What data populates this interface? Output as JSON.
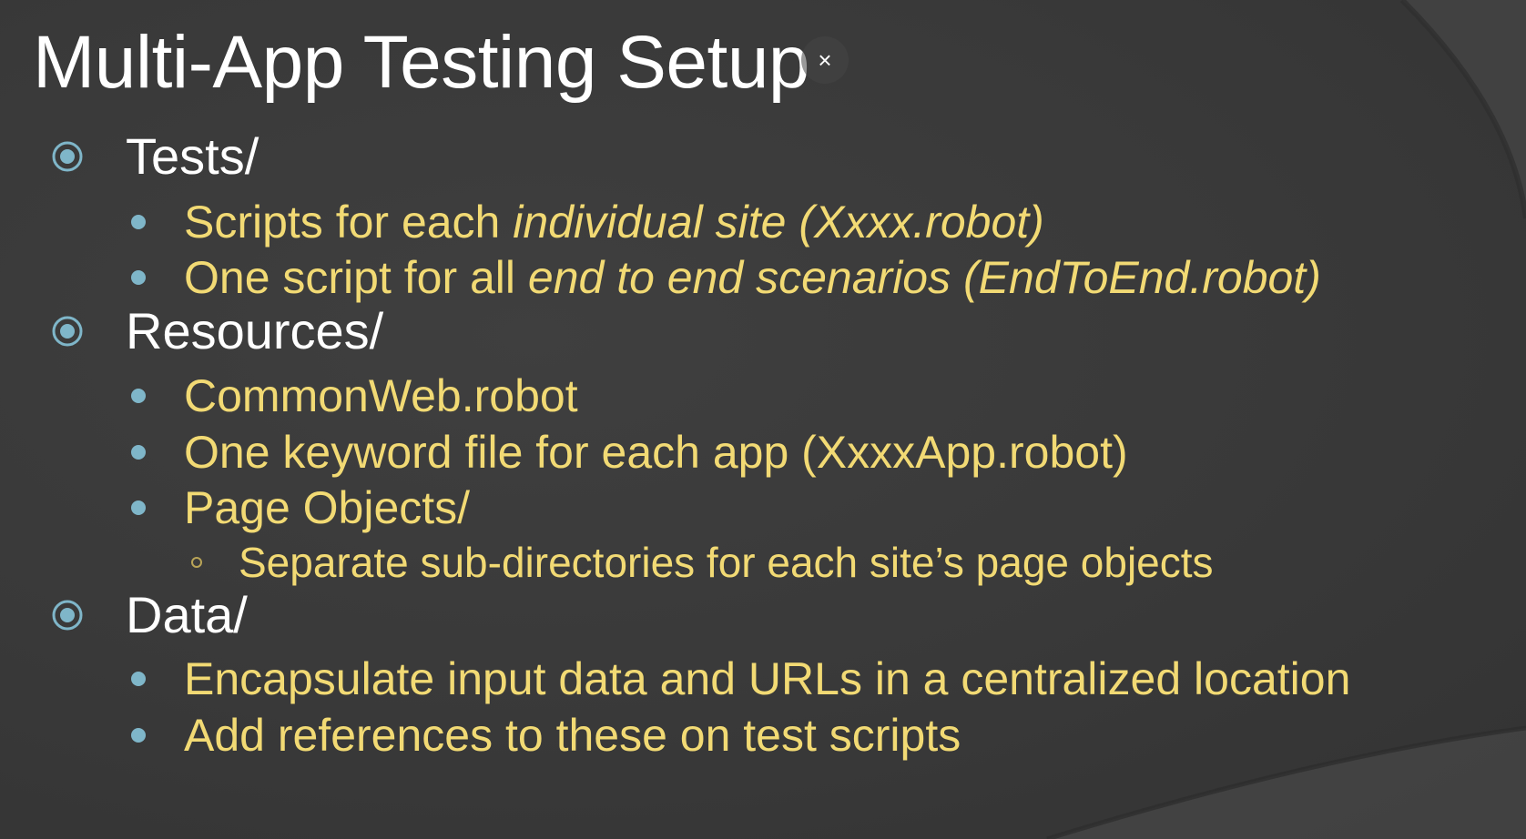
{
  "slide": {
    "title": "Multi-App Testing Setup",
    "close_label": "×"
  },
  "colors": {
    "background": "#3a3a3a",
    "title_text": "#ffffff",
    "level1_text": "#ffffff",
    "level2_text": "#f2da74",
    "bullet_accent": "#7fb6c9"
  },
  "icons": {
    "level1_bullet": "concentric-circle-icon",
    "level2_bullet": "filled-dot-icon",
    "level3_bullet": "hollow-circle-icon",
    "close": "close-icon"
  },
  "sections": [
    {
      "heading": "Tests/",
      "items": [
        {
          "normal": "Scripts for each ",
          "italic": "individual site (Xxxx.robot)"
        },
        {
          "normal": "One script for all ",
          "italic": "end to end scenarios (EndToEnd.robot)"
        }
      ]
    },
    {
      "heading": "Resources/",
      "items": [
        {
          "normal": "CommonWeb.robot",
          "italic": ""
        },
        {
          "normal": "One keyword file for each app (XxxxApp.robot)",
          "italic": ""
        },
        {
          "normal": "Page Objects/",
          "italic": ""
        }
      ],
      "subitems": [
        "Separate sub-directories for each site’s page objects"
      ]
    },
    {
      "heading": "Data/",
      "items": [
        {
          "normal": "Encapsulate input data and URLs in a centralized location",
          "italic": ""
        },
        {
          "normal": "Add references to these on test scripts",
          "italic": ""
        }
      ]
    }
  ]
}
